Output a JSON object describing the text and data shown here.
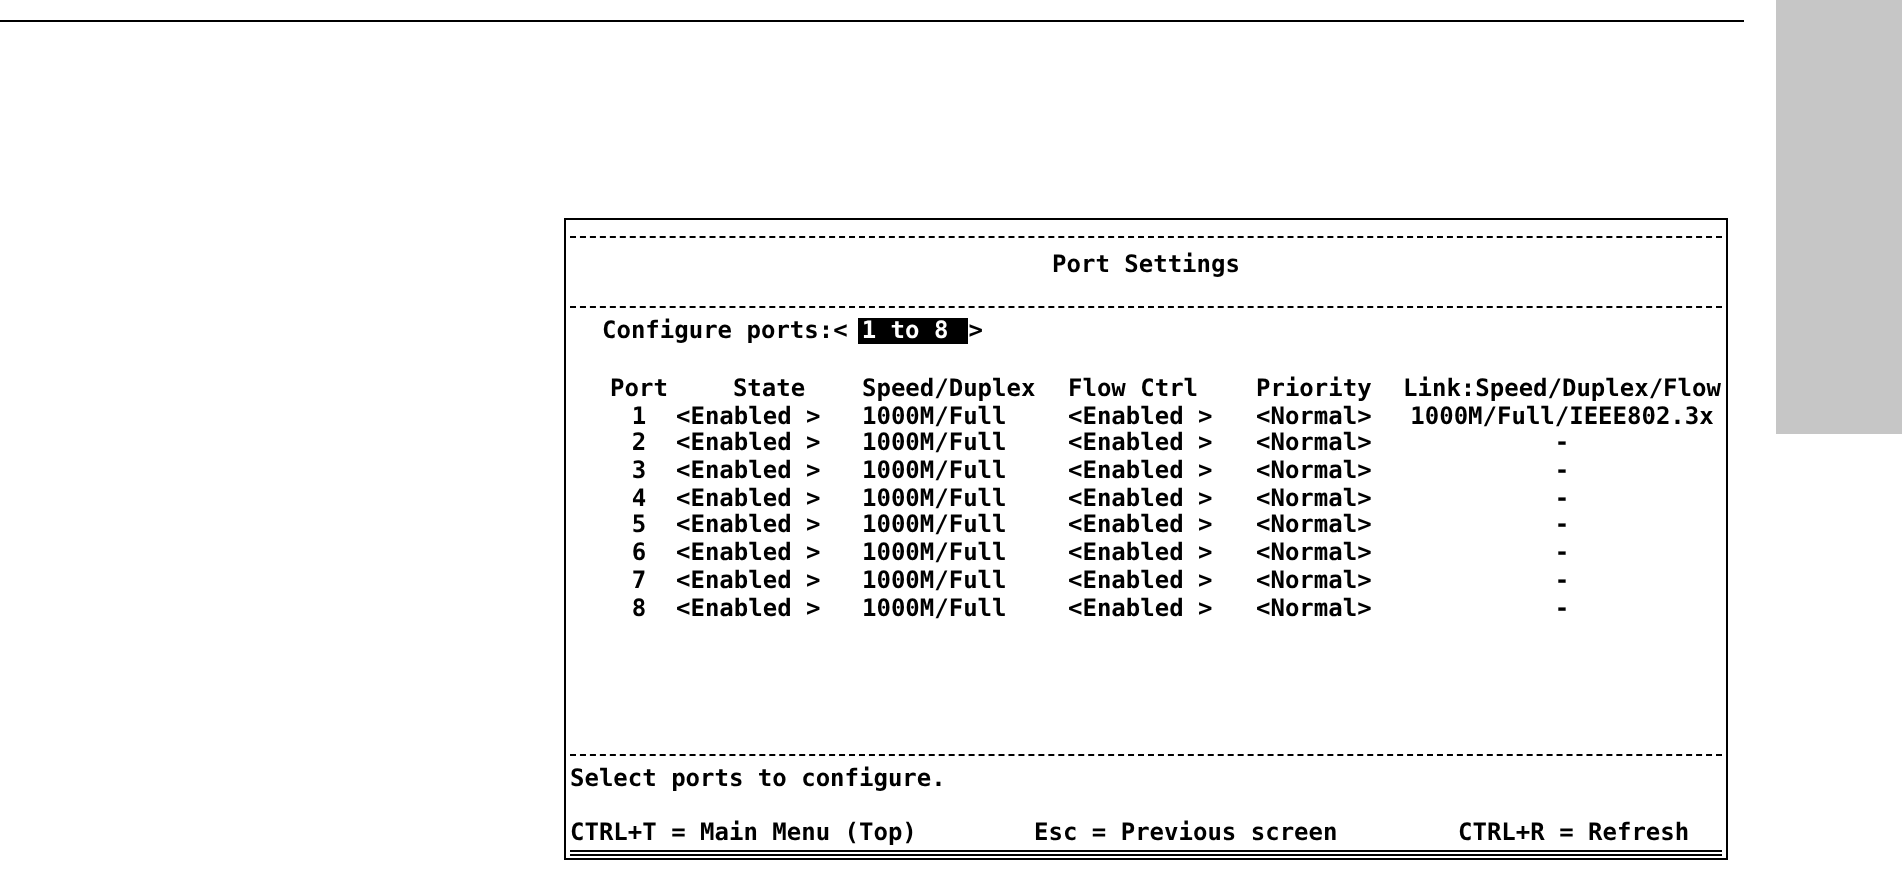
{
  "terminal": {
    "title": "Port Settings",
    "configure": {
      "label": "Configure ports:<",
      "value": "1 to 8",
      "selected": true,
      "suffix": ">"
    },
    "table": {
      "columns": [
        "Port",
        "State",
        "Speed/Duplex",
        "Flow Ctrl",
        "Priority",
        "Link:Speed/Duplex/Flow"
      ],
      "rows": [
        [
          "1",
          "<Enabled >",
          "1000M/Full",
          "<Enabled >",
          "<Normal>",
          "1000M/Full/IEEE802.3x"
        ],
        [
          "2",
          "<Enabled >",
          "1000M/Full",
          "<Enabled >",
          "<Normal>",
          "-"
        ],
        [
          "3",
          "<Enabled >",
          "1000M/Full",
          "<Enabled >",
          "<Normal>",
          "-"
        ],
        [
          "4",
          "<Enabled >",
          "1000M/Full",
          "<Enabled >",
          "<Normal>",
          "-"
        ],
        [
          "5",
          "<Enabled >",
          "1000M/Full",
          "<Enabled >",
          "<Normal>",
          "-"
        ],
        [
          "6",
          "<Enabled >",
          "1000M/Full",
          "<Enabled >",
          "<Normal>",
          "-"
        ],
        [
          "7",
          "<Enabled >",
          "1000M/Full",
          "<Enabled >",
          "<Normal>",
          "-"
        ],
        [
          "8",
          "<Enabled >",
          "1000M/Full",
          "<Enabled >",
          "<Normal>",
          "-"
        ]
      ]
    },
    "status": "Select ports to configure.",
    "shortcuts": [
      "CTRL+T = Main Menu (Top)",
      "Esc = Previous screen",
      "CTRL+R = Refresh"
    ]
  }
}
